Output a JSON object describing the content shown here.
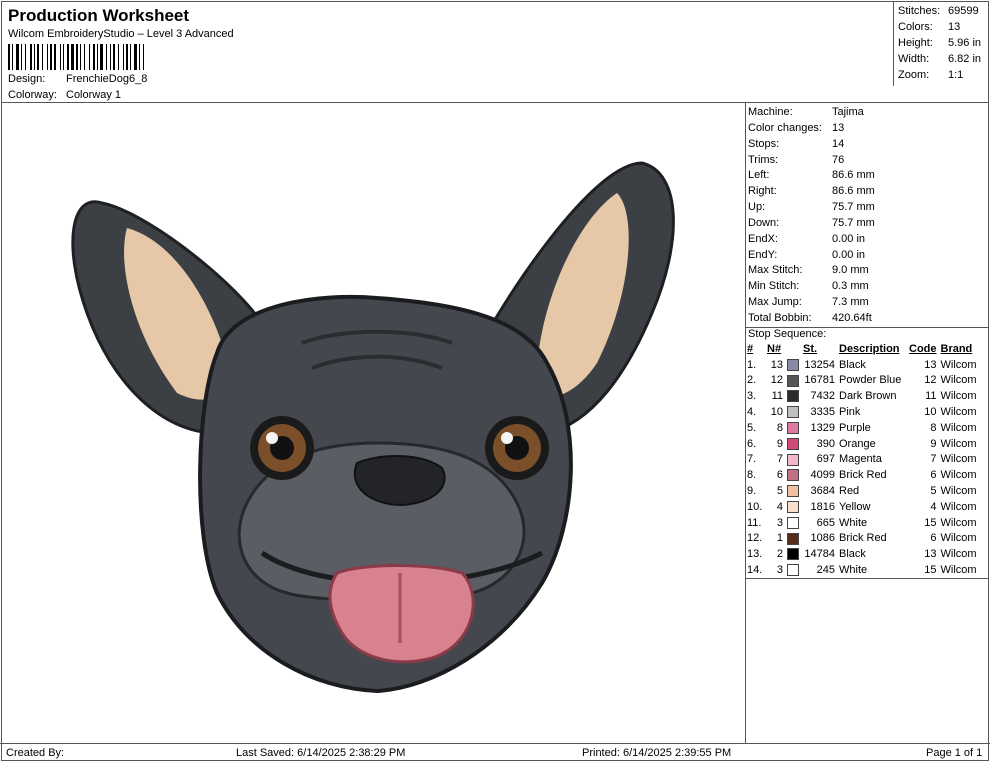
{
  "header": {
    "title": "Production Worksheet",
    "subtitle": "Wilcom EmbroideryStudio – Level 3 Advanced",
    "design_label": "Design:",
    "design_value": "FrenchieDog6_8",
    "colorway_label": "Colorway:",
    "colorway_value": "Colorway 1"
  },
  "summary": [
    {
      "label": "Stitches:",
      "value": "69599"
    },
    {
      "label": "Colors:",
      "value": "13"
    },
    {
      "label": "Height:",
      "value": "5.96 in"
    },
    {
      "label": "Width:",
      "value": "6.82 in"
    },
    {
      "label": "Zoom:",
      "value": "1:1"
    }
  ],
  "details": [
    {
      "label": "Machine:",
      "value": "Tajima"
    },
    {
      "label": "Color changes:",
      "value": "13"
    },
    {
      "label": "Stops:",
      "value": "14"
    },
    {
      "label": "Trims:",
      "value": "76"
    },
    {
      "label": "Left:",
      "value": "86.6 mm"
    },
    {
      "label": "Right:",
      "value": "86.6 mm"
    },
    {
      "label": "Up:",
      "value": "75.7 mm"
    },
    {
      "label": "Down:",
      "value": "75.7 mm"
    },
    {
      "label": "EndX:",
      "value": "0.00 in"
    },
    {
      "label": "EndY:",
      "value": "0.00 in"
    },
    {
      "label": "Max Stitch:",
      "value": "9.0 mm"
    },
    {
      "label": "Min Stitch:",
      "value": "0.3 mm"
    },
    {
      "label": "Max Jump:",
      "value": "7.3 mm"
    },
    {
      "label": "Total Bobbin:",
      "value": "420.64ft"
    }
  ],
  "stop_sequence": {
    "title": "Stop Sequence:",
    "columns": [
      "#",
      "N#",
      "St.",
      "Description",
      "Code",
      "Brand"
    ],
    "rows": [
      {
        "idx": "1.",
        "n": "13",
        "color": "#8a8aa8",
        "st": "13254",
        "desc": "Black",
        "code": "13",
        "brand": "Wilcom"
      },
      {
        "idx": "2.",
        "n": "12",
        "color": "#555555",
        "st": "16781",
        "desc": "Powder Blue",
        "code": "12",
        "brand": "Wilcom"
      },
      {
        "idx": "3.",
        "n": "11",
        "color": "#2a2a2a",
        "st": "7432",
        "desc": "Dark Brown",
        "code": "11",
        "brand": "Wilcom"
      },
      {
        "idx": "4.",
        "n": "10",
        "color": "#c0c0c0",
        "st": "3335",
        "desc": "Pink",
        "code": "10",
        "brand": "Wilcom"
      },
      {
        "idx": "5.",
        "n": "8",
        "color": "#e07aa0",
        "st": "1329",
        "desc": "Purple",
        "code": "8",
        "brand": "Wilcom"
      },
      {
        "idx": "6.",
        "n": "9",
        "color": "#d04a78",
        "st": "390",
        "desc": "Orange",
        "code": "9",
        "brand": "Wilcom"
      },
      {
        "idx": "7.",
        "n": "7",
        "color": "#f0b8c8",
        "st": "697",
        "desc": "Magenta",
        "code": "7",
        "brand": "Wilcom"
      },
      {
        "idx": "8.",
        "n": "6",
        "color": "#c07080",
        "st": "4099",
        "desc": "Brick Red",
        "code": "6",
        "brand": "Wilcom"
      },
      {
        "idx": "9.",
        "n": "5",
        "color": "#f0c0a0",
        "st": "3684",
        "desc": "Red",
        "code": "5",
        "brand": "Wilcom"
      },
      {
        "idx": "10.",
        "n": "4",
        "color": "#f8e0d0",
        "st": "1816",
        "desc": "Yellow",
        "code": "4",
        "brand": "Wilcom"
      },
      {
        "idx": "11.",
        "n": "3",
        "color": "#ffffff",
        "st": "665",
        "desc": "White",
        "code": "15",
        "brand": "Wilcom"
      },
      {
        "idx": "12.",
        "n": "1",
        "color": "#5a2a1a",
        "st": "1086",
        "desc": "Brick Red",
        "code": "6",
        "brand": "Wilcom"
      },
      {
        "idx": "13.",
        "n": "2",
        "color": "#000000",
        "st": "14784",
        "desc": "Black",
        "code": "13",
        "brand": "Wilcom"
      },
      {
        "idx": "14.",
        "n": "3",
        "color": "#ffffff",
        "st": "245",
        "desc": "White",
        "code": "15",
        "brand": "Wilcom"
      }
    ]
  },
  "footer": {
    "created_by": "Created By:",
    "last_saved": "Last Saved: 6/14/2025 2:38:29 PM",
    "printed": "Printed: 6/14/2025 2:39:55 PM",
    "page": "Page 1 of 1"
  }
}
